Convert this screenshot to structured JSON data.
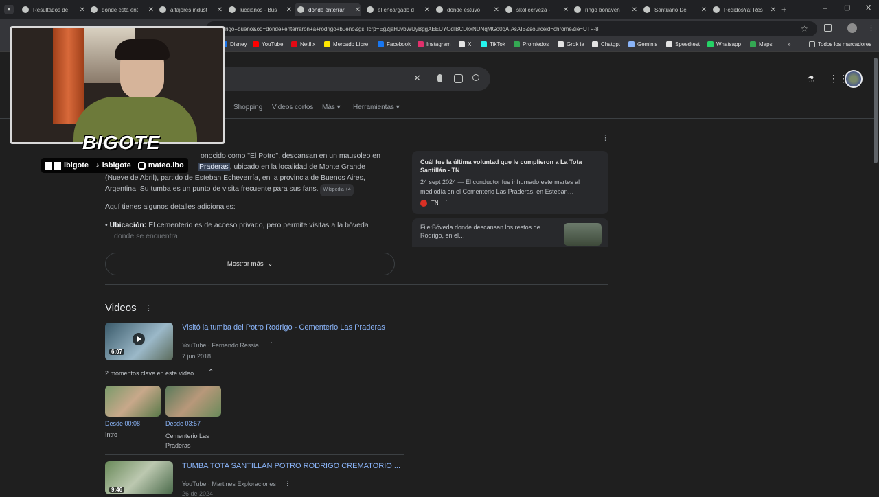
{
  "tabs": [
    {
      "title": "Resultados de",
      "active": false
    },
    {
      "title": "donde esta ent",
      "active": false
    },
    {
      "title": "alfajores indust",
      "active": false
    },
    {
      "title": "luccianos - Bus",
      "active": false
    },
    {
      "title": "donde enterrar",
      "active": true
    },
    {
      "title": "el encargado d",
      "active": false
    },
    {
      "title": "donde estuvo",
      "active": false
    },
    {
      "title": "skol cerveza -",
      "active": false
    },
    {
      "title": "ringo bonaven",
      "active": false
    },
    {
      "title": "Santuario Del",
      "active": false
    },
    {
      "title": "PedidosYa! Res",
      "active": false
    }
  ],
  "address_url": "rigo+bueno&oq=donde+enterraron+a+rodrigo+bueno&gs_lcrp=EgZjaHJvbWUyBggAEEUYOdIBCDkxNDNqMGo0qAIAsAIB&sourceid=chrome&ie=UTF-8",
  "bookmarks": [
    {
      "label": "Disney",
      "color": "#1a73e8"
    },
    {
      "label": "YouTube",
      "color": "#ff0000"
    },
    {
      "label": "Netflix",
      "color": "#e50914"
    },
    {
      "label": "Mercado Libre",
      "color": "#ffe600"
    },
    {
      "label": "Facebook",
      "color": "#1877f2"
    },
    {
      "label": "Instagram",
      "color": "#e1306c"
    },
    {
      "label": "X",
      "color": "#e3e3e3"
    },
    {
      "label": "TikTok",
      "color": "#25f4ee"
    },
    {
      "label": "Promiedos",
      "color": "#34a853"
    },
    {
      "label": "Grok ia",
      "color": "#e3e3e3"
    },
    {
      "label": "Chatgpt",
      "color": "#e3e3e3"
    },
    {
      "label": "Geminis",
      "color": "#8ab4f8"
    },
    {
      "label": "Speedtest",
      "color": "#e3e3e3"
    },
    {
      "label": "Whatsapp",
      "color": "#25d366"
    },
    {
      "label": "Maps",
      "color": "#34a853"
    }
  ],
  "bookmarks_more": "»",
  "all_bookmarks": "Todos los marcadores",
  "nav_tabs": [
    "Shopping",
    "Videos cortos",
    "Más ▾",
    "Herramientas ▾"
  ],
  "answer": {
    "line1": "onocido como \"El Potro\", descansan en un mausoleo en",
    "line2_highlight": "Praderas",
    "line2_rest": ", ubicado en la localidad de Monte Grande",
    "line3": "(Nueve de Abril), partido de Esteban Echeverría, en la provincia de Buenos Aires,",
    "line4": "Argentina. Su tumba es un punto de visita frecuente para sus fans.",
    "source_chip": "Wikipedia +4",
    "details_intro": "Aquí tienes algunos detalles adicionales:",
    "bullet_label": "Ubicación:",
    "bullet_text": "El cementerio es de acceso privado, pero permite visitas a la bóveda",
    "bullet_text2": "donde se encuentra",
    "show_more": "Mostrar más"
  },
  "side_card": {
    "title": "Cuál fue la última voluntad que le cumplieron a La Tota Santillán - TN",
    "snippet": "24 sept 2024 — El conductor fue inhumado este martes al mediodía en el Cementerio Las Praderas, en Esteban…",
    "source": "TN",
    "file_title": "File:Bóveda donde descansan los restos de Rodrigo, en el…"
  },
  "videos_heading": "Videos",
  "videos": [
    {
      "title": "Visitó la tumba del Potro Rodrigo - Cementerio Las Praderas",
      "channel": "YouTube · Fernando Ressia",
      "date": "7 jun 2018",
      "duration": "6:07"
    },
    {
      "title": "TUMBA TOTA SANTILLAN POTRO RODRIGO CREMATORIO ...",
      "channel": "YouTube · Martines Exploraciones",
      "date": "26 de 2024",
      "duration": "9:46"
    }
  ],
  "key_moments": {
    "label": "2 momentos clave en este video",
    "items": [
      {
        "time": "Desde 00:08",
        "label": "Intro"
      },
      {
        "time": "Desde 03:57",
        "label": "Cementerio Las Praderas"
      }
    ]
  },
  "overlay": {
    "logo": "BIGOTE",
    "twitch_kick": "ibigote",
    "tiktok": "isbigote",
    "instagram": "mateo.lbo"
  },
  "colors": {
    "link": "#8ab4f8",
    "bg": "#1f1f1f"
  }
}
